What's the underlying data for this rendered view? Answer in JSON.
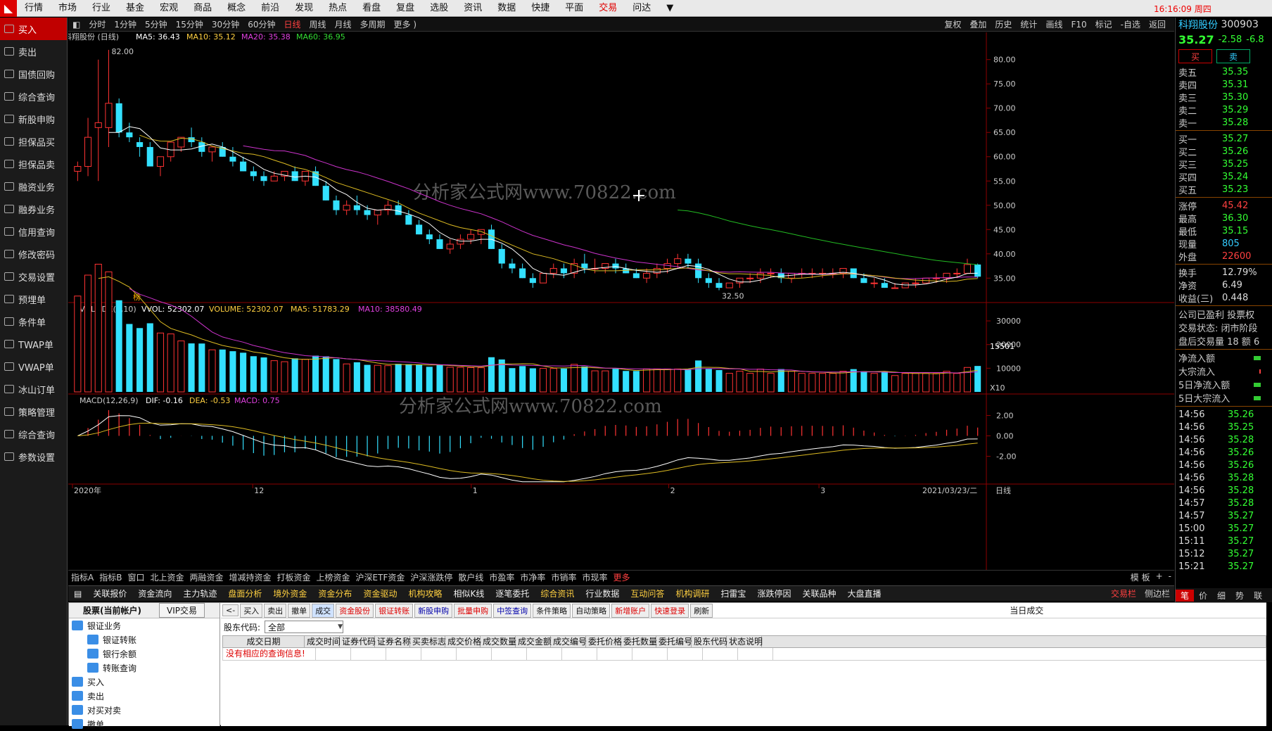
{
  "menu": [
    "行情",
    "市场",
    "行业",
    "基金",
    "宏观",
    "商品",
    "概念",
    "前沿",
    "发现",
    "热点",
    "看盘",
    "复盘",
    "选股",
    "资讯",
    "数据",
    "快捷",
    "平面",
    "交易",
    "问达",
    "▼"
  ],
  "menu_active": "交易",
  "clock": "16:16:09 周四",
  "sidebar": [
    "买入",
    "卖出",
    "国债回购",
    "综合查询",
    "新股申购",
    "担保品买",
    "担保品卖",
    "融资业务",
    "融券业务",
    "信用查询",
    "修改密码",
    "交易设置",
    "预埋单",
    "条件单",
    "TWAP单",
    "VWAP单",
    "冰山订单",
    "策略管理",
    "综合查询",
    "参数设置"
  ],
  "periods": [
    "分时",
    "1分钟",
    "5分钟",
    "15分钟",
    "30分钟",
    "60分钟",
    "日线",
    "周线",
    "月线",
    "多周期",
    "更多 )"
  ],
  "period_active": "日线",
  "chart_tools": [
    "复权",
    "叠加",
    "历史",
    "统计",
    "画线",
    "F10",
    "标记",
    "-自选",
    "返回"
  ],
  "main_legend": {
    "name": "科翔股份 (日线)",
    "ma5": "MA5: 36.43",
    "ma10": "MA10: 35.12",
    "ma20": "MA20: 35.38",
    "ma60": "MA60: 36.95"
  },
  "vol_legend": {
    "name": "VOL-TDX(5,10)",
    "vvol": "VVOL: 52302.07",
    "volume": "VOLUME: 52302.07",
    "ma5": "MA5: 51783.29",
    "ma10": "MA10: 38580.49"
  },
  "macd_legend": {
    "name": "MACD(12,26,9)",
    "dif": "DIF: -0.16",
    "dea": "DEA: -0.53",
    "macd": "MACD: 0.75"
  },
  "price_axis": [
    "80.00",
    "75.00",
    "70.00",
    "65.00",
    "60.00",
    "55.00",
    "50.00",
    "45.00",
    "40.00",
    "35.00"
  ],
  "vol_axis": [
    "30000",
    "20000",
    "10000"
  ],
  "vol_tag": "15501",
  "vol_unit": "X10",
  "macd_axis": [
    "2.00",
    "0.00",
    "-2.00"
  ],
  "high_label": "82.00",
  "low_label": "32.50",
  "bang": "榜",
  "date_axis": [
    "2020年",
    "12",
    "1",
    "2",
    "3"
  ],
  "date_end": "2021/03/23/二",
  "date_period": "日线",
  "watermark": "分析家公式网www.70822.com",
  "indicators": [
    "指标A",
    "指标B",
    "窗口",
    "北上资金",
    "两融资金",
    "增减持资金",
    "打板资金",
    "上榜资金",
    "沪深ETF资金",
    "沪深涨跌停",
    "散户线",
    "市盈率",
    "市净率",
    "市销率",
    "市现率",
    "更多"
  ],
  "ind_right": [
    "模 板",
    "+",
    "-"
  ],
  "func_items": [
    "关联报价",
    "资金流向",
    "主力轨迹",
    "盘面分析",
    "境外资金",
    "资金分布",
    "资金驱动",
    "机构攻略",
    "相似K线",
    "逐笔委托",
    "综合资讯",
    "行业数据",
    "互动问答",
    "机构调研",
    "扫雷宝",
    "涨跌停因",
    "关联品种",
    "大盘直播"
  ],
  "func_highlight": [
    "盘面分析",
    "境外资金",
    "资金分布",
    "资金驱动",
    "机构攻略",
    "综合资讯",
    "互动问答",
    "机构调研"
  ],
  "func_right": [
    "交易栏",
    "侧边栏"
  ],
  "account": {
    "title": "股票(当前帐户)",
    "vip": "VIP交易",
    "tree": [
      {
        "label": "银证业务",
        "sub": false
      },
      {
        "label": "银证转账",
        "sub": true
      },
      {
        "label": "银行余额",
        "sub": true
      },
      {
        "label": "转账查询",
        "sub": true
      },
      {
        "label": "买入",
        "sub": false
      },
      {
        "label": "卖出",
        "sub": false
      },
      {
        "label": "对买对卖",
        "sub": false
      },
      {
        "label": "撤单",
        "sub": false
      }
    ]
  },
  "trade": {
    "buttons": [
      "<-",
      "买入",
      "卖出",
      "撤单",
      "成交",
      "资金股份",
      "银证转账",
      "新股申购",
      "批量申购",
      "中签查询",
      "条件策略",
      "自动策略",
      "新增账户",
      "快速登录",
      "刷新"
    ],
    "title": "当日成交",
    "filter_label": "股东代码:",
    "filter_value": "全部",
    "columns": [
      "成交日期",
      "成交时间",
      "证券代码",
      "证券名称",
      "买卖标志",
      "成交价格",
      "成交数量",
      "成交金额",
      "成交编号",
      "委托价格",
      "委托数量",
      "委托编号",
      "股东代码",
      "状态说明"
    ],
    "empty_msg": "没有相应的查询信息!"
  },
  "quote": {
    "name": "科翔股份",
    "code": "300903",
    "price": "35.27",
    "change": "-2.58",
    "pct": "-6.8",
    "buy": "买",
    "sell": "卖",
    "asks": [
      [
        "卖五",
        "35.35"
      ],
      [
        "卖四",
        "35.31"
      ],
      [
        "卖三",
        "35.30"
      ],
      [
        "卖二",
        "35.29"
      ],
      [
        "卖一",
        "35.28"
      ]
    ],
    "bids": [
      [
        "买一",
        "35.27"
      ],
      [
        "买二",
        "35.26"
      ],
      [
        "买三",
        "35.25"
      ],
      [
        "买四",
        "35.24"
      ],
      [
        "买五",
        "35.23"
      ]
    ],
    "stats": [
      [
        "涨停",
        "45.42"
      ],
      [
        "最高",
        "36.30"
      ],
      [
        "最低",
        "35.15"
      ],
      [
        "现量",
        "805"
      ],
      [
        "外盘",
        "22600"
      ]
    ],
    "stats2": [
      [
        "换手",
        "12.79%"
      ],
      [
        "净资",
        "6.49"
      ],
      [
        "收益(三)",
        "0.448"
      ]
    ],
    "info": [
      "公司已盈利 投票权",
      "交易状态: 闭市阶段",
      "盘后交易量 18 额 6"
    ],
    "flows": [
      "净流入额",
      "大宗流入",
      "5日净流入额",
      "5日大宗流入"
    ],
    "ticks": [
      [
        "14:56",
        "35.26"
      ],
      [
        "14:56",
        "35.25"
      ],
      [
        "14:56",
        "35.28"
      ],
      [
        "14:56",
        "35.26"
      ],
      [
        "14:56",
        "35.26"
      ],
      [
        "14:56",
        "35.28"
      ],
      [
        "14:56",
        "35.28"
      ],
      [
        "14:57",
        "35.28"
      ],
      [
        "14:57",
        "35.27"
      ],
      [
        "15:00",
        "35.27"
      ],
      [
        "15:11",
        "35.27"
      ],
      [
        "15:12",
        "35.27"
      ],
      [
        "15:21",
        "35.27"
      ]
    ],
    "bottom_tabs": [
      "笔",
      "价",
      "细",
      "势",
      "联"
    ]
  },
  "chart_data": {
    "type": "candlestick",
    "title": "科翔股份 (日线)",
    "ylim": [
      32,
      83
    ],
    "candles": [
      [
        57,
        59,
        55,
        58
      ],
      [
        58,
        68,
        56,
        64
      ],
      [
        66,
        80,
        55,
        67
      ],
      [
        66,
        82,
        62,
        71
      ],
      [
        71,
        72,
        64,
        65
      ],
      [
        65,
        67,
        63,
        64
      ],
      [
        63,
        64,
        60,
        62
      ],
      [
        62,
        63,
        58,
        58
      ],
      [
        58,
        60,
        56,
        60
      ],
      [
        60,
        63,
        59,
        63
      ],
      [
        62,
        64,
        61,
        64
      ],
      [
        64,
        66,
        62,
        63
      ],
      [
        63,
        64,
        60,
        61
      ],
      [
        61,
        62,
        59,
        62
      ],
      [
        62,
        63,
        60,
        60
      ],
      [
        60,
        62,
        58,
        59
      ],
      [
        59,
        60,
        57,
        57
      ],
      [
        57,
        58,
        55,
        56
      ],
      [
        56,
        57,
        54,
        55
      ],
      [
        55,
        57,
        55,
        56
      ],
      [
        56,
        57,
        55,
        57
      ],
      [
        57,
        58,
        55,
        55
      ],
      [
        55,
        57,
        54,
        57
      ],
      [
        57,
        58,
        54,
        54
      ],
      [
        54,
        55,
        51,
        51
      ],
      [
        51,
        52,
        48,
        49
      ],
      [
        49,
        51,
        48,
        50
      ],
      [
        50,
        52,
        48,
        49
      ],
      [
        49,
        50,
        47,
        48
      ],
      [
        48,
        49,
        46,
        49
      ],
      [
        49,
        51,
        48,
        50
      ],
      [
        50,
        51,
        48,
        48
      ],
      [
        48,
        49,
        46,
        46
      ],
      [
        46,
        47,
        44,
        44
      ],
      [
        44,
        45,
        42,
        43
      ],
      [
        43,
        44,
        41,
        41
      ],
      [
        41,
        43,
        40,
        42
      ],
      [
        42,
        44,
        41,
        43
      ],
      [
        43,
        45,
        42,
        44
      ],
      [
        44,
        45,
        42,
        45
      ],
      [
        45,
        46,
        41,
        41
      ],
      [
        41,
        42,
        37,
        38
      ],
      [
        38,
        39,
        36,
        37
      ],
      [
        37,
        38,
        35,
        35
      ],
      [
        35,
        36,
        33,
        34
      ],
      [
        34,
        36,
        34,
        36
      ],
      [
        36,
        38,
        35,
        37
      ],
      [
        37,
        38,
        35,
        36
      ],
      [
        36,
        39,
        35,
        38
      ],
      [
        38,
        40,
        36,
        37
      ],
      [
        37,
        39,
        36,
        37
      ],
      [
        37,
        38,
        36,
        38
      ],
      [
        38,
        39,
        36,
        37
      ],
      [
        37,
        38,
        36,
        36
      ],
      [
        36,
        37,
        35,
        35
      ],
      [
        35,
        37,
        34,
        36
      ],
      [
        36,
        38,
        35,
        37
      ],
      [
        37,
        39,
        36,
        38
      ],
      [
        38,
        40,
        37,
        39
      ],
      [
        39,
        40,
        37,
        38
      ],
      [
        38,
        39,
        34,
        35
      ],
      [
        35,
        36,
        33,
        34
      ],
      [
        34,
        35,
        32.5,
        33
      ],
      [
        33,
        34,
        33,
        34
      ],
      [
        34,
        35,
        33,
        35
      ],
      [
        35,
        36,
        34,
        35
      ],
      [
        35,
        37,
        34,
        36
      ],
      [
        36,
        37,
        35,
        36
      ],
      [
        36,
        37,
        34,
        35
      ],
      [
        35,
        36,
        34,
        36
      ],
      [
        36,
        37,
        35,
        36
      ],
      [
        36,
        37,
        35,
        36
      ],
      [
        36,
        37,
        35,
        36
      ],
      [
        36,
        37,
        35,
        36
      ],
      [
        36,
        37,
        35,
        37
      ],
      [
        37,
        37,
        35,
        35
      ],
      [
        35,
        36,
        34,
        34
      ],
      [
        34,
        35,
        33,
        34
      ],
      [
        34,
        35,
        33,
        33
      ],
      [
        33,
        34,
        33,
        33
      ],
      [
        33,
        34,
        33,
        34
      ],
      [
        34,
        35,
        33,
        34
      ],
      [
        34,
        35,
        34,
        35
      ],
      [
        35,
        36,
        34,
        35
      ],
      [
        35,
        36,
        34,
        36
      ],
      [
        36,
        37,
        35,
        36
      ],
      [
        36,
        39,
        36,
        37.8
      ],
      [
        37.8,
        38,
        35,
        35.3
      ]
    ]
  }
}
